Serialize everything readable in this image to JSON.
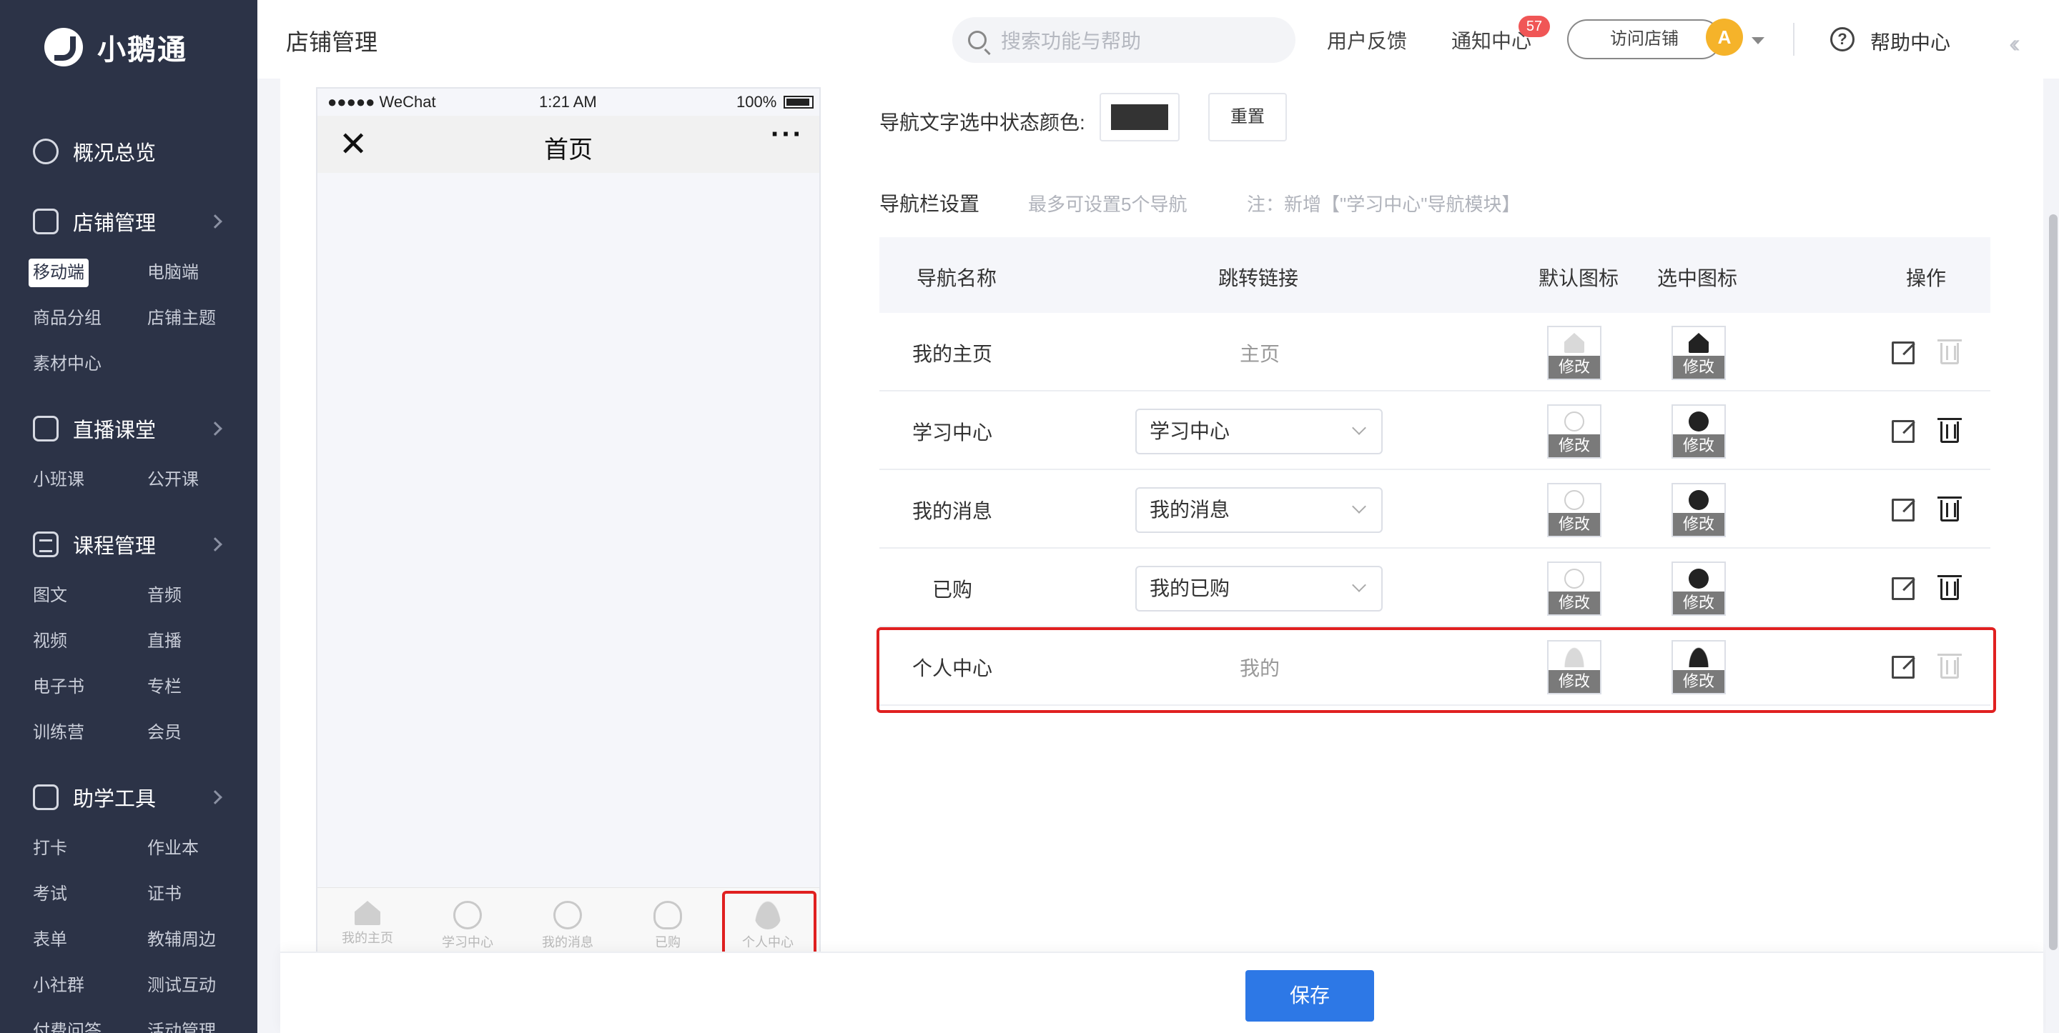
{
  "brand": {
    "name": "小鹅通"
  },
  "sidebar": {
    "groups": [
      {
        "label": "概况总览",
        "items": []
      },
      {
        "label": "店铺管理",
        "items": [
          "移动端",
          "电脑端",
          "商品分组",
          "店铺主题",
          "素材中心"
        ]
      },
      {
        "label": "直播课堂",
        "items": [
          "小班课",
          "公开课"
        ]
      },
      {
        "label": "课程管理",
        "items": [
          "图文",
          "音频",
          "视频",
          "直播",
          "电子书",
          "专栏",
          "训练营",
          "会员"
        ]
      },
      {
        "label": "助学工具",
        "items": [
          "打卡",
          "作业本",
          "考试",
          "证书",
          "表单",
          "教辅周边",
          "小社群",
          "测试互动",
          "付费问答",
          "活动管理"
        ]
      }
    ]
  },
  "header": {
    "title": "店铺管理",
    "search_placeholder": "搜索功能与帮助",
    "feedback": "用户反馈",
    "notifications": "通知中心",
    "notification_count": "57",
    "visit_store": "访问店铺",
    "avatar_text": "A",
    "help": "帮助中心"
  },
  "phone": {
    "carrier": "●●●●● WeChat",
    "time": "1:21 AM",
    "battery": "100%",
    "title": "首页",
    "tabs": [
      "我的主页",
      "学习中心",
      "我的消息",
      "已购",
      "个人中心"
    ]
  },
  "settings": {
    "color_label": "导航文字选中状态颜色:",
    "selected_color": "#333333",
    "reset": "重置",
    "section_title": "导航栏设置",
    "section_hint": "最多可设置5个导航",
    "section_note": "注：新增【\"学习中心\"导航模块】",
    "columns": [
      "导航名称",
      "跳转链接",
      "默认图标",
      "选中图标",
      "操作"
    ],
    "modify": "修改",
    "rows": [
      {
        "name": "我的主页",
        "link": "主页",
        "select": null
      },
      {
        "name": "学习中心",
        "link": null,
        "select": "学习中心"
      },
      {
        "name": "我的消息",
        "link": null,
        "select": "我的消息"
      },
      {
        "name": "已购",
        "link": null,
        "select": "我的已购"
      },
      {
        "name": "个人中心",
        "link": "我的",
        "select": null
      }
    ]
  },
  "footer": {
    "save": "保存"
  }
}
